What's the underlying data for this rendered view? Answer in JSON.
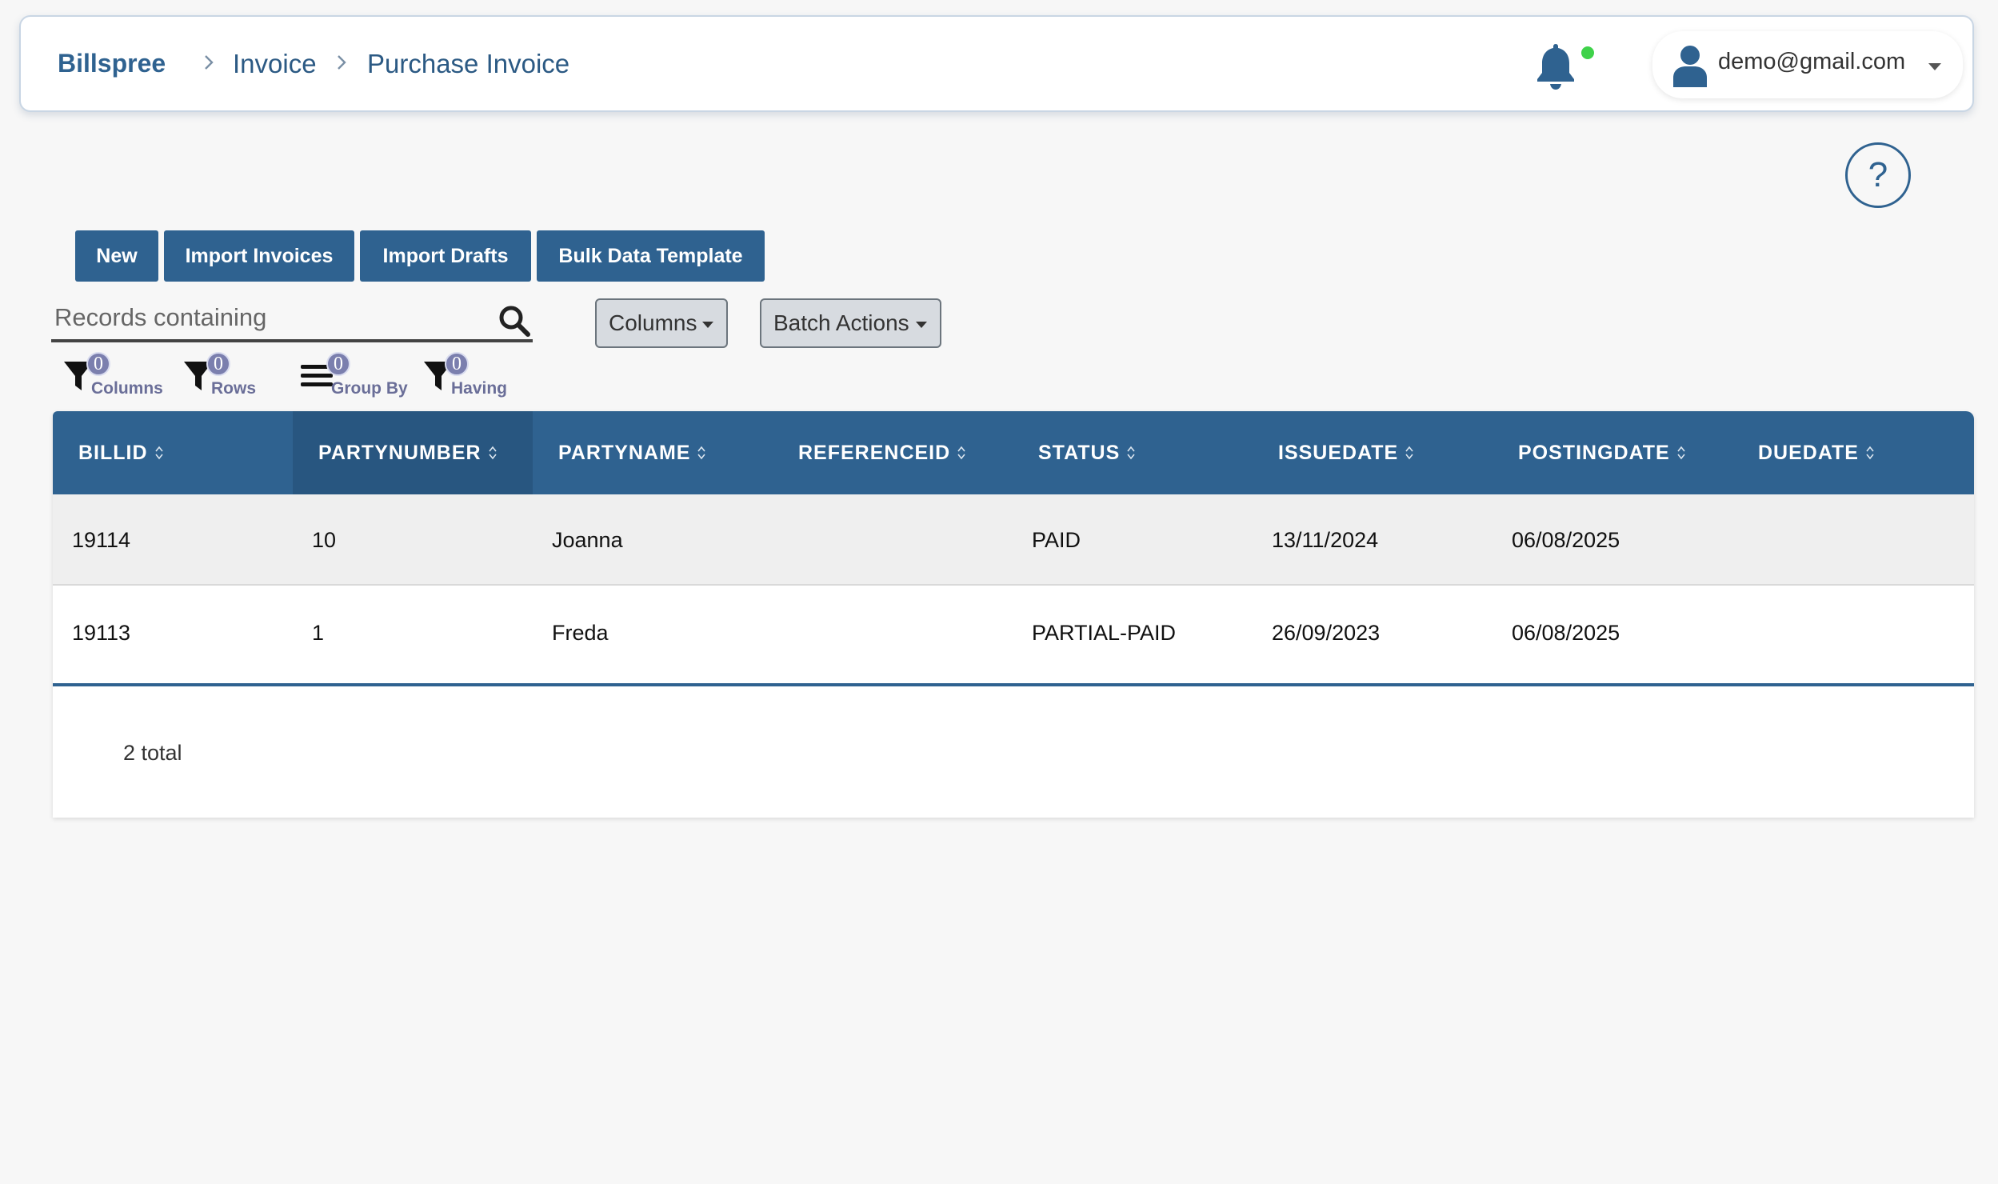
{
  "header": {
    "brand": "Billspree",
    "breadcrumbs": [
      "Invoice",
      "Purchase Invoice"
    ],
    "user_email": "demo@gmail.com",
    "notification_status_color": "#3fd24a"
  },
  "help": {
    "label": "?"
  },
  "toolbar": {
    "new_label": "New",
    "import_invoices_label": "Import Invoices",
    "import_drafts_label": "Import Drafts",
    "bulk_template_label": "Bulk Data Template"
  },
  "search": {
    "placeholder": "Records containing",
    "value": ""
  },
  "dropdowns": {
    "columns_label": "Columns",
    "batch_actions_label": "Batch Actions"
  },
  "filters": [
    {
      "label": "Columns",
      "count": "0",
      "icon": "filter-icon"
    },
    {
      "label": "Rows",
      "count": "0",
      "icon": "filter-icon"
    },
    {
      "label": "Group By",
      "count": "0",
      "icon": "list-icon"
    },
    {
      "label": "Having",
      "count": "0",
      "icon": "filter-icon"
    }
  ],
  "table": {
    "columns": [
      "BILLID",
      "PARTYNUMBER",
      "PARTYNAME",
      "REFERENCEID",
      "STATUS",
      "ISSUEDATE",
      "POSTINGDATE",
      "DUEDATE"
    ],
    "active_column": "PARTYNUMBER",
    "rows": [
      [
        "19114",
        "10",
        "Joanna",
        "",
        "PAID",
        "13/11/2024",
        "06/08/2025",
        ""
      ],
      [
        "19113",
        "1",
        "Freda",
        "",
        "PARTIAL-PAID",
        "26/09/2023",
        "06/08/2025",
        ""
      ]
    ],
    "total_label": "2 total"
  },
  "colors": {
    "primary": "#2f6290",
    "header_active": "#285680",
    "badge": "#7b7fae"
  }
}
